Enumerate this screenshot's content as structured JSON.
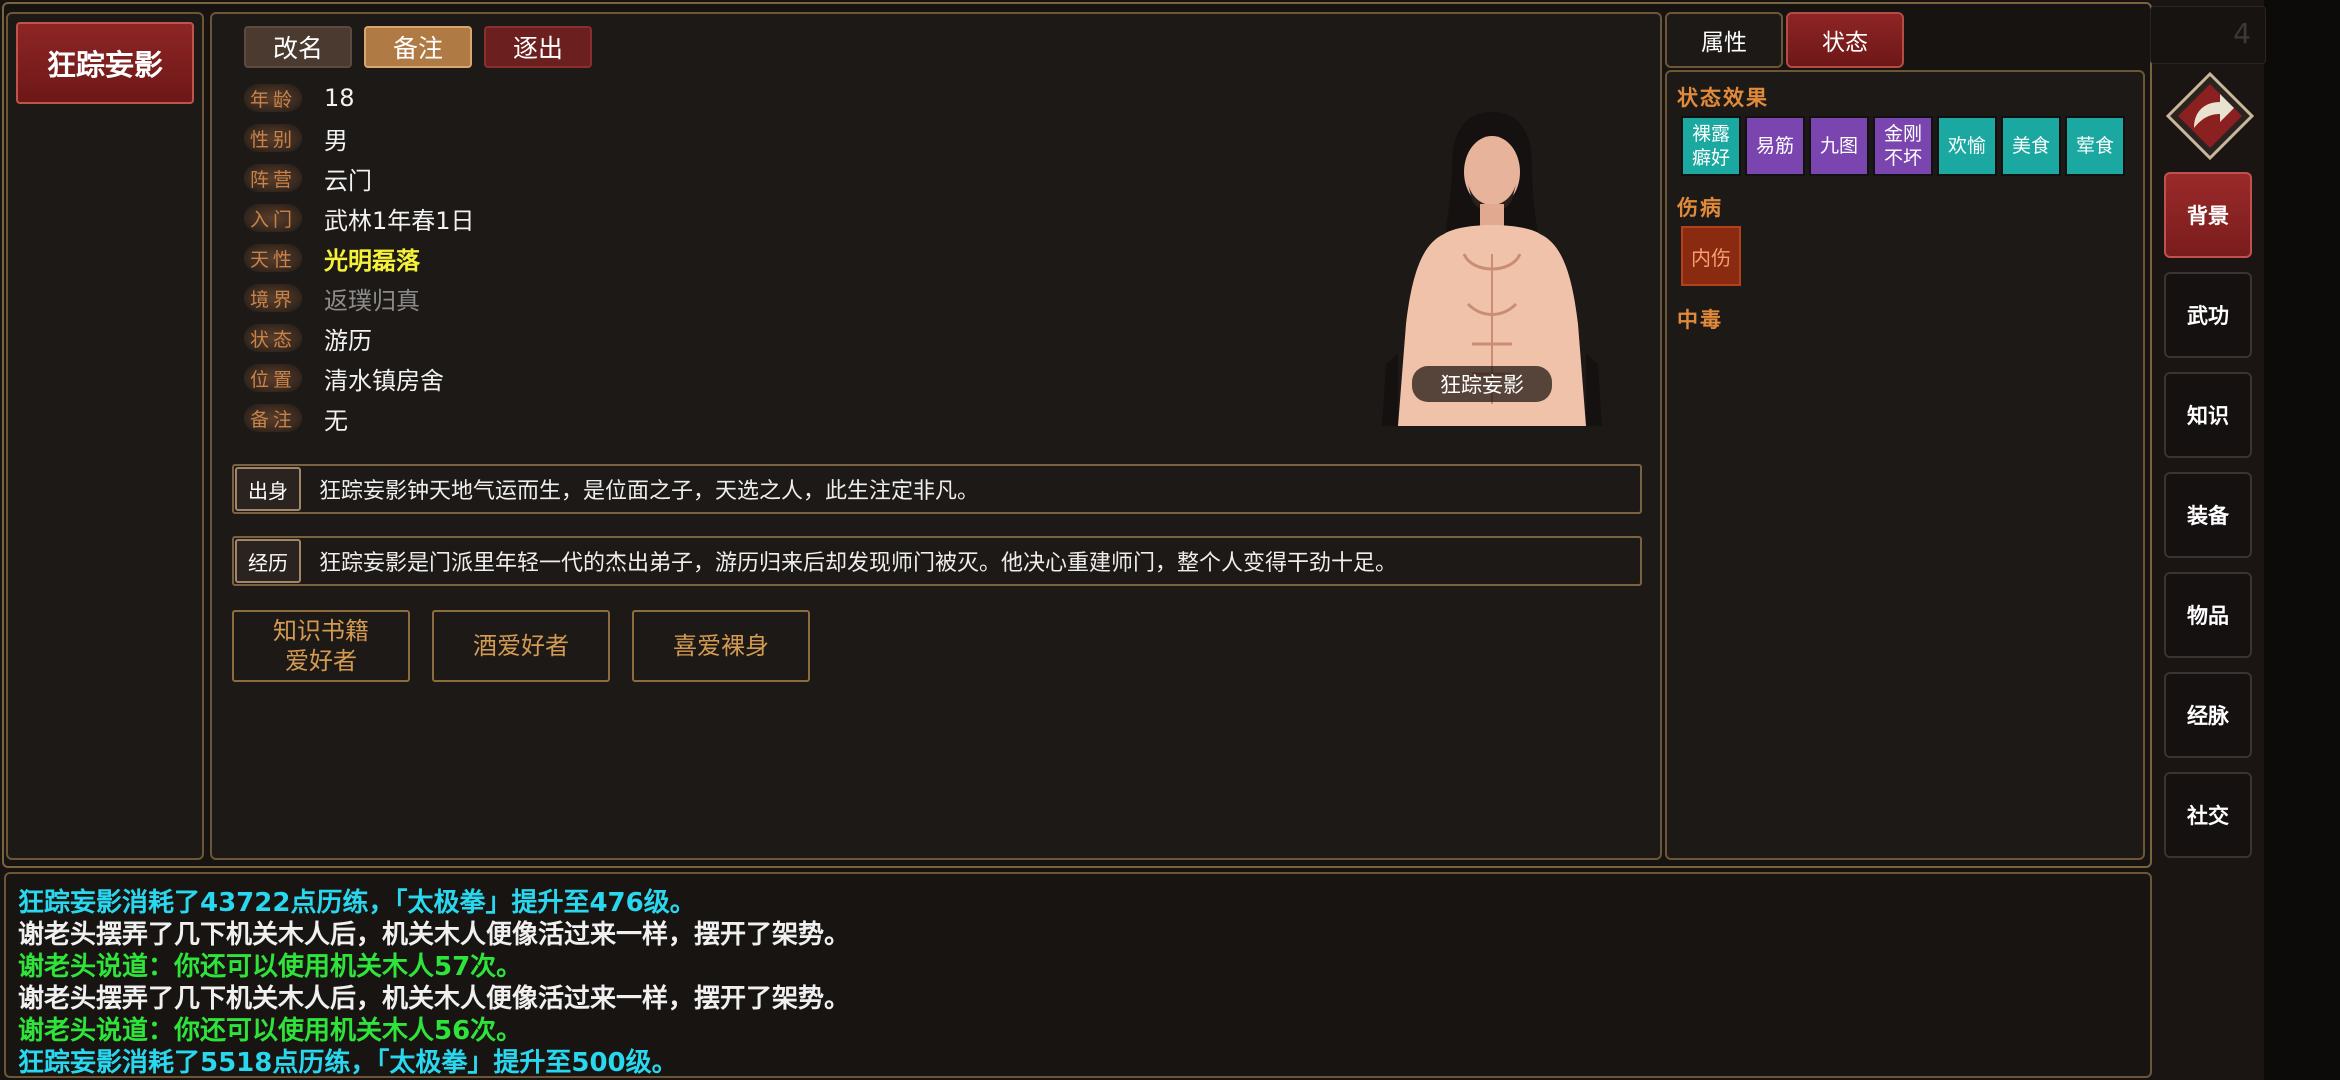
{
  "character": {
    "name": "狂踪妄影",
    "portrait_caption": "狂踪妄影"
  },
  "actions": {
    "rename": "改名",
    "note": "备注",
    "expel": "逐出"
  },
  "attributes": [
    {
      "label": "年龄",
      "value": "18"
    },
    {
      "label": "性别",
      "value": "男"
    },
    {
      "label": "阵营",
      "value": "云门"
    },
    {
      "label": "入门",
      "value": "武林1年春1日"
    },
    {
      "label": "天性",
      "value": "光明磊落"
    },
    {
      "label": "境界",
      "value": "返璞归真"
    },
    {
      "label": "状态",
      "value": "游历"
    },
    {
      "label": "位置",
      "value": "清水镇房舍"
    },
    {
      "label": "备注",
      "value": "无"
    }
  ],
  "story": {
    "origin_tag": "出身",
    "origin_text": "狂踪妄影钟天地气运而生，是位面之子，天选之人，此生注定非凡。",
    "experience_tag": "经历",
    "experience_text": "狂踪妄影是门派里年轻一代的杰出弟子，游历归来后却发现师门被灭。他决心重建师门，整个人变得干劲十足。"
  },
  "traits": [
    "知识书籍\n爱好者",
    "酒爱好者",
    "喜爱裸身"
  ],
  "right_tabs": {
    "attributes": "属性",
    "status": "状态"
  },
  "status_panel": {
    "effects_title": "状态效果",
    "effects": [
      {
        "label": "裸露\n癖好",
        "color": "#1aa8a0"
      },
      {
        "label": "易筋",
        "color": "#7b45b0"
      },
      {
        "label": "九图",
        "color": "#7b45b0"
      },
      {
        "label": "金刚\n不坏",
        "color": "#7b45b0"
      },
      {
        "label": "欢愉",
        "color": "#1aa8a0"
      },
      {
        "label": "美食",
        "color": "#1aa8a0"
      },
      {
        "label": "荤食",
        "color": "#1aa8a0"
      }
    ],
    "injury_title": "伤病",
    "injuries": [
      "内伤"
    ],
    "poison_title": "中毒"
  },
  "nav": {
    "back_icon": "back-arrow-icon",
    "top_stub": "4",
    "items": [
      "背景",
      "武功",
      "知识",
      "装备",
      "物品",
      "经脉",
      "社交"
    ],
    "active": "背景"
  },
  "log": [
    {
      "text": "狂踪妄影消耗了43722点历练，「太极拳」提升至476级。",
      "color": "#29d8ee"
    },
    {
      "text": "谢老头摆弄了几下机关木人后，机关木人便像活过来一样，摆开了架势。",
      "color": "#f0f0f0"
    },
    {
      "text": "谢老头说道：你还可以使用机关木人57次。",
      "color": "#2ee43a"
    },
    {
      "text": "谢老头摆弄了几下机关木人后，机关木人便像活过来一样，摆开了架势。",
      "color": "#f0f0f0"
    },
    {
      "text": "谢老头说道：你还可以使用机关木人56次。",
      "color": "#2ee43a"
    },
    {
      "text": "狂踪妄影消耗了5518点历练，「太极拳」提升至500级。",
      "color": "#29d8ee"
    }
  ]
}
